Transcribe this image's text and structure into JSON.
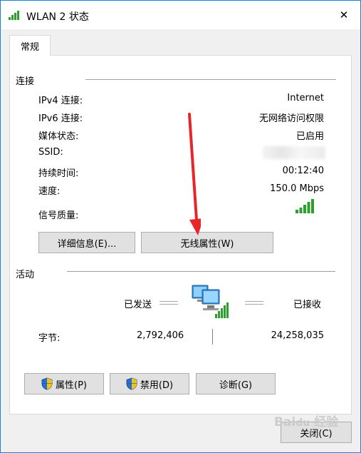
{
  "window": {
    "title": "WLAN 2 状态",
    "close_glyph": "✕"
  },
  "tabs": [
    {
      "label": "常规",
      "selected": true
    }
  ],
  "connection": {
    "title": "连接",
    "rows": [
      {
        "label": "IPv4 连接:",
        "value": "Internet"
      },
      {
        "label": "IPv6 连接:",
        "value": "无网络访问权限"
      },
      {
        "label": "媒体状态:",
        "value": "已启用"
      },
      {
        "label": "SSID:",
        "value": ""
      },
      {
        "label": "持续时间:",
        "value": "00:12:40"
      },
      {
        "label": "速度:",
        "value": "150.0 Mbps"
      },
      {
        "label": "信号质量:",
        "value": ""
      }
    ],
    "signal_level": 1.0,
    "buttons": {
      "details": "详细信息(E)...",
      "wireless_properties": "无线属性(W)"
    }
  },
  "activity": {
    "title": "活动",
    "sent_label": "已发送",
    "received_label": "已接收",
    "bytes_label": "字节:",
    "bytes_sent": "2,792,406",
    "bytes_received": "24,258,035"
  },
  "bottom_buttons": {
    "properties": "属性(P)",
    "disable": "禁用(D)",
    "diagnose": "诊断(G)"
  },
  "close_button": "关闭(C)",
  "colors": {
    "accent_border": "#1883d7",
    "signal": "#2e9e2e",
    "arrow": "#e8252a"
  },
  "icons": [
    "wifi-signal-icon",
    "network-computers-icon",
    "shield-icon",
    "close-icon"
  ]
}
